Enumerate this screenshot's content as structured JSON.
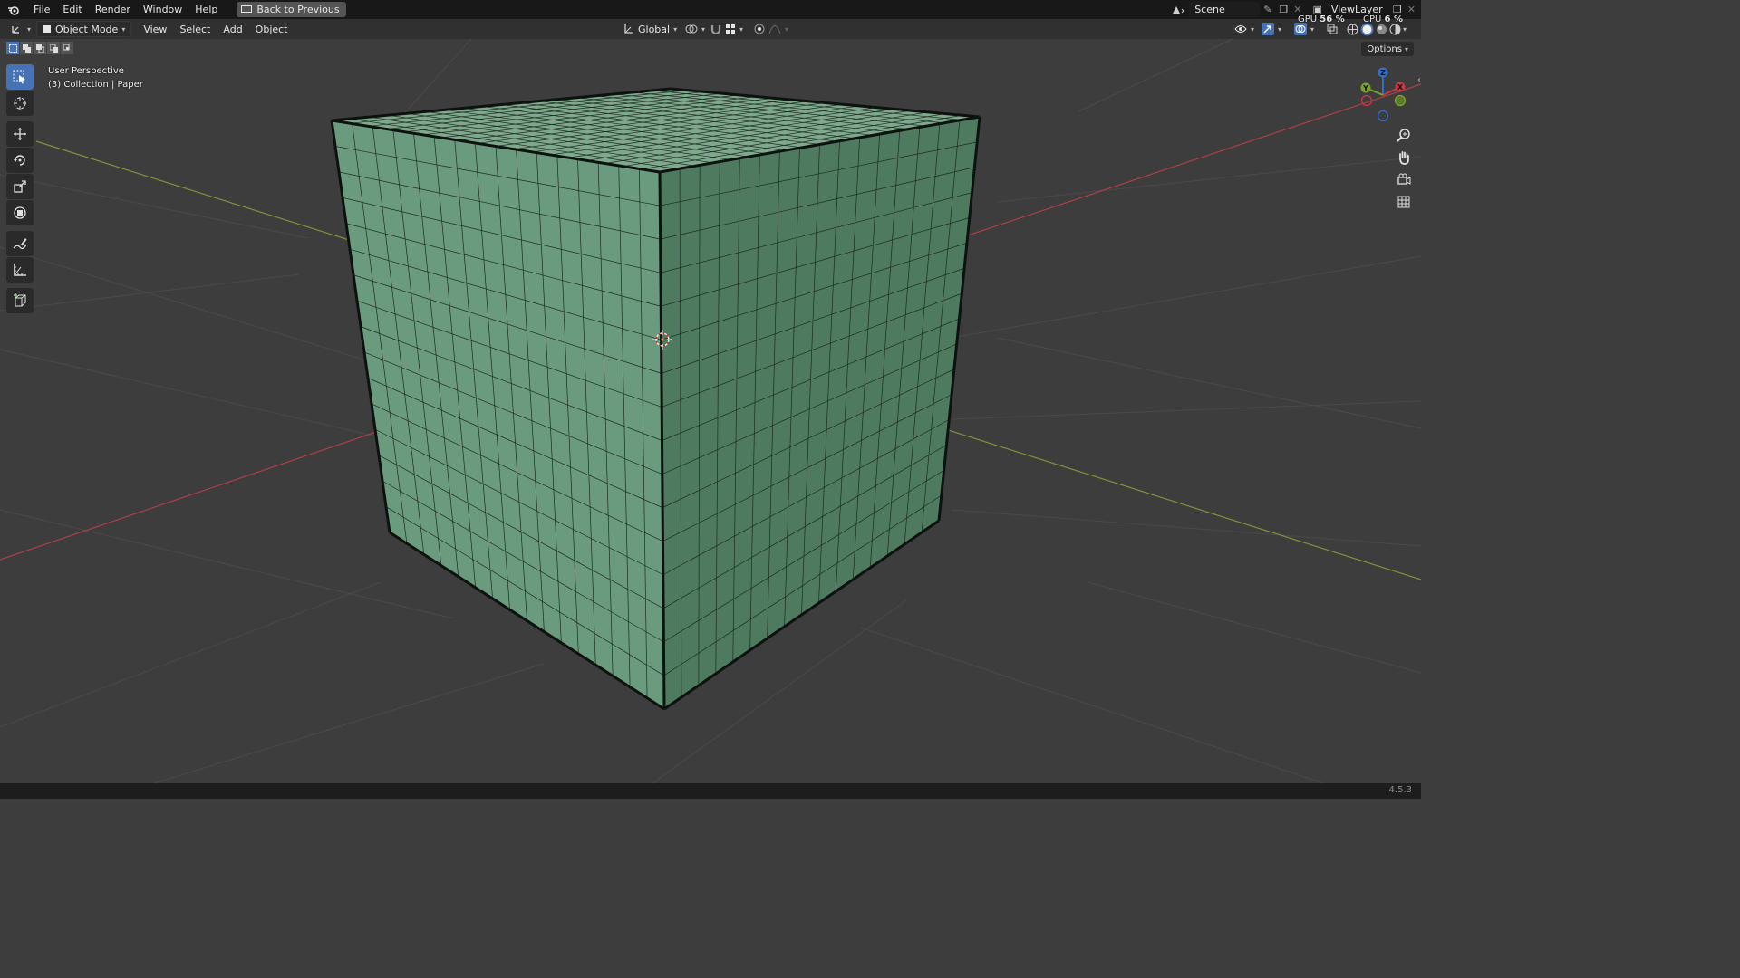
{
  "menu": {
    "file": "File",
    "edit": "Edit",
    "render": "Render",
    "window": "Window",
    "help": "Help",
    "back_to_previous": "Back to Previous"
  },
  "top_right": {
    "scene": "Scene",
    "view_layer": "ViewLayer",
    "gpu_label": "GPU",
    "gpu_value": "56 %",
    "cpu_label": "CPU",
    "cpu_value": "6 %"
  },
  "header": {
    "mode": "Object Mode",
    "view": "View",
    "select": "Select",
    "add": "Add",
    "object": "Object",
    "transform_orientation": "Global"
  },
  "viewport": {
    "perspective": "User Perspective",
    "collection": "(3) Collection | Paper",
    "options": "Options",
    "gizmo_labels": {
      "z": "Z",
      "y": "Y",
      "x": "X"
    }
  },
  "status": {
    "version": "4.5.3"
  },
  "colors": {
    "cube_left": "#6b9b7e",
    "cube_right": "#4e7a60",
    "cube_top": "#7ea98d",
    "axis_x": "#c0404a",
    "axis_y": "#8aa23a",
    "accent": "#4772b3"
  }
}
